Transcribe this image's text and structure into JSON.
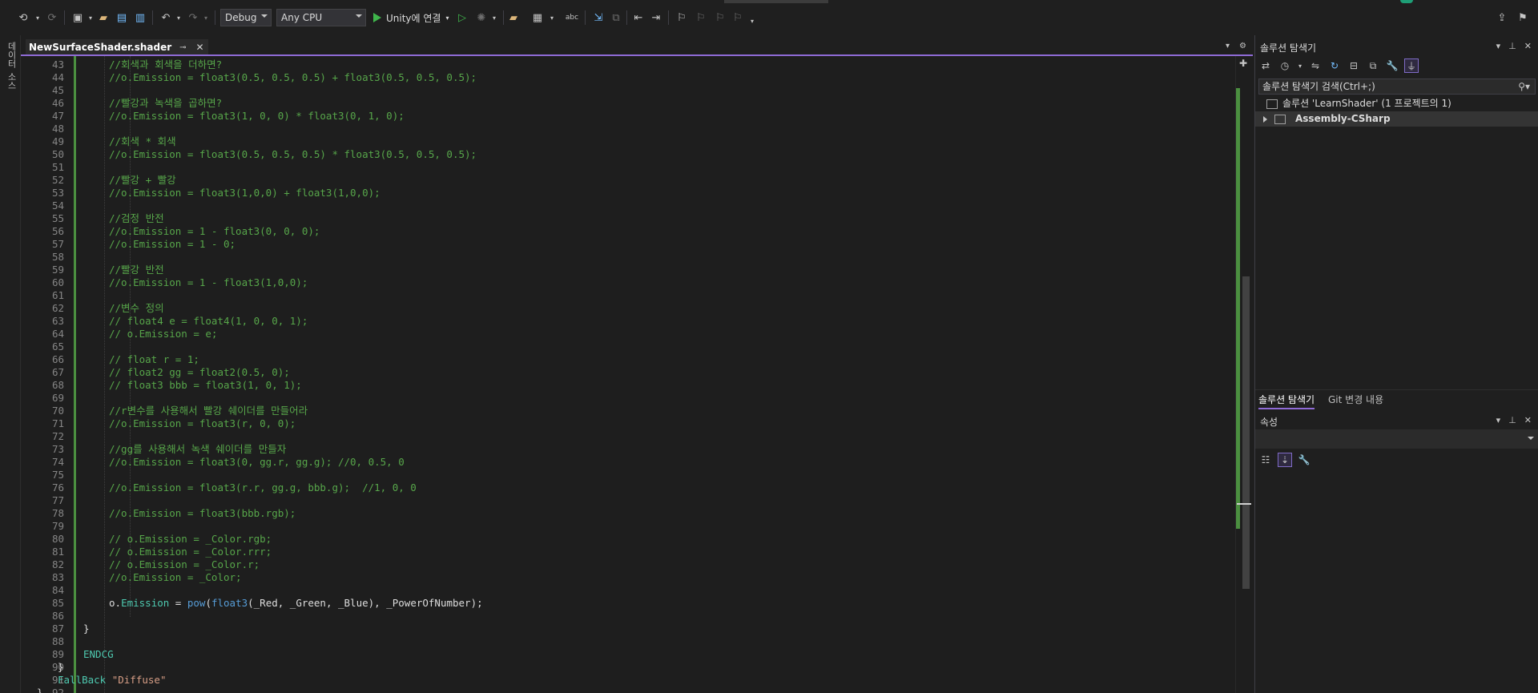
{
  "toolbar": {
    "config": "Debug",
    "platform": "Any CPU",
    "run_label": "Unity에 연결"
  },
  "left_strip": {
    "tab1": "데이터",
    "tab2": "소스"
  },
  "editor": {
    "tab_title": "NewSurfaceShader.shader",
    "lines": [
      {
        "n": "43",
        "t": "//회색과 회색을 더하면?",
        "c": "cm"
      },
      {
        "n": "44",
        "t": "//o.Emission = float3(0.5, 0.5, 0.5) + float3(0.5, 0.5, 0.5);",
        "c": "cm"
      },
      {
        "n": "45",
        "t": "",
        "c": "pl"
      },
      {
        "n": "46",
        "t": "//빨강과 녹색을 곱하면?",
        "c": "cm"
      },
      {
        "n": "47",
        "t": "//o.Emission = float3(1, 0, 0) * float3(0, 1, 0);",
        "c": "cm"
      },
      {
        "n": "48",
        "t": "",
        "c": "pl"
      },
      {
        "n": "49",
        "t": "//회색 * 회색",
        "c": "cm"
      },
      {
        "n": "50",
        "t": "//o.Emission = float3(0.5, 0.5, 0.5) * float3(0.5, 0.5, 0.5);",
        "c": "cm"
      },
      {
        "n": "51",
        "t": "",
        "c": "pl"
      },
      {
        "n": "52",
        "t": "//빨강 + 빨강",
        "c": "cm"
      },
      {
        "n": "53",
        "t": "//o.Emission = float3(1,0,0) + float3(1,0,0);",
        "c": "cm"
      },
      {
        "n": "54",
        "t": "",
        "c": "pl"
      },
      {
        "n": "55",
        "t": "//검정 반전",
        "c": "cm"
      },
      {
        "n": "56",
        "t": "//o.Emission = 1 - float3(0, 0, 0);",
        "c": "cm"
      },
      {
        "n": "57",
        "t": "//o.Emission = 1 - 0;",
        "c": "cm"
      },
      {
        "n": "58",
        "t": "",
        "c": "pl"
      },
      {
        "n": "59",
        "t": "//빨강 반전",
        "c": "cm"
      },
      {
        "n": "60",
        "t": "//o.Emission = 1 - float3(1,0,0);",
        "c": "cm"
      },
      {
        "n": "61",
        "t": "",
        "c": "pl"
      },
      {
        "n": "62",
        "t": "//변수 정의",
        "c": "cm"
      },
      {
        "n": "63",
        "t": "// float4 e = float4(1, 0, 0, 1);",
        "c": "cm"
      },
      {
        "n": "64",
        "t": "// o.Emission = e;",
        "c": "cm"
      },
      {
        "n": "65",
        "t": "",
        "c": "pl"
      },
      {
        "n": "66",
        "t": "// float r = 1;",
        "c": "cm"
      },
      {
        "n": "67",
        "t": "// float2 gg = float2(0.5, 0);",
        "c": "cm"
      },
      {
        "n": "68",
        "t": "// float3 bbb = float3(1, 0, 1);",
        "c": "cm"
      },
      {
        "n": "69",
        "t": "",
        "c": "pl"
      },
      {
        "n": "70",
        "t": "//r변수를 사용해서 빨강 쉐이더를 만들어라",
        "c": "cm"
      },
      {
        "n": "71",
        "t": "//o.Emission = float3(r, 0, 0);",
        "c": "cm"
      },
      {
        "n": "72",
        "t": "",
        "c": "pl"
      },
      {
        "n": "73",
        "t": "//gg를 사용해서 녹색 쉐이더를 만들자",
        "c": "cm"
      },
      {
        "n": "74",
        "t": "//o.Emission = float3(0, gg.r, gg.g); //0, 0.5, 0",
        "c": "cm"
      },
      {
        "n": "75",
        "t": "",
        "c": "pl"
      },
      {
        "n": "76",
        "t": "//o.Emission = float3(r.r, gg.g, bbb.g);  //1, 0, 0",
        "c": "cm"
      },
      {
        "n": "77",
        "t": "",
        "c": "pl"
      },
      {
        "n": "78",
        "t": "//o.Emission = float3(bbb.rgb);",
        "c": "cm"
      },
      {
        "n": "79",
        "t": "",
        "c": "pl"
      },
      {
        "n": "80",
        "t": "// o.Emission = _Color.rgb;",
        "c": "cm"
      },
      {
        "n": "81",
        "t": "// o.Emission = _Color.rrr;",
        "c": "cm"
      },
      {
        "n": "82",
        "t": "// o.Emission = _Color.r;",
        "c": "cm"
      },
      {
        "n": "83",
        "t": "//o.Emission = _Color;",
        "c": "cm"
      },
      {
        "n": "84",
        "t": "",
        "c": "pl"
      },
      {
        "n": "85",
        "segs": [
          {
            "t": "o.",
            "c": "pl"
          },
          {
            "t": "Emission",
            "c": "kw"
          },
          {
            "t": " = ",
            "c": "pl"
          },
          {
            "t": "pow",
            "c": "fn"
          },
          {
            "t": "(",
            "c": "pl"
          },
          {
            "t": "float3",
            "c": "fn"
          },
          {
            "t": "(_Red, _Green, _Blue), _PowerOfNumber);",
            "c": "pl"
          }
        ]
      },
      {
        "n": "86",
        "t": "",
        "c": "pl"
      },
      {
        "n": "87",
        "t": "}",
        "c": "pl"
      },
      {
        "n": "88",
        "t": "",
        "c": "pl"
      },
      {
        "n": "89",
        "t": "ENDCG",
        "c": "kw"
      },
      {
        "n": "90",
        "t": "}",
        "c": "pl"
      },
      {
        "n": "91",
        "segs": [
          {
            "t": "FallBack ",
            "c": "kw"
          },
          {
            "t": "\"Diffuse\"",
            "c": "str"
          }
        ]
      },
      {
        "n": "92",
        "t": "}",
        "c": "pl"
      }
    ]
  },
  "solution_explorer": {
    "title": "솔루션 탐색기",
    "search_placeholder": "솔루션 탐색기 검색(Ctrl+;)",
    "solution_label": "솔루션 'LearnShader' (1 프로젝트의 1)",
    "project_label": "Assembly-CSharp",
    "tab_solution": "솔루션 탐색기",
    "tab_git": "Git 변경 내용"
  },
  "properties": {
    "title": "속성"
  }
}
